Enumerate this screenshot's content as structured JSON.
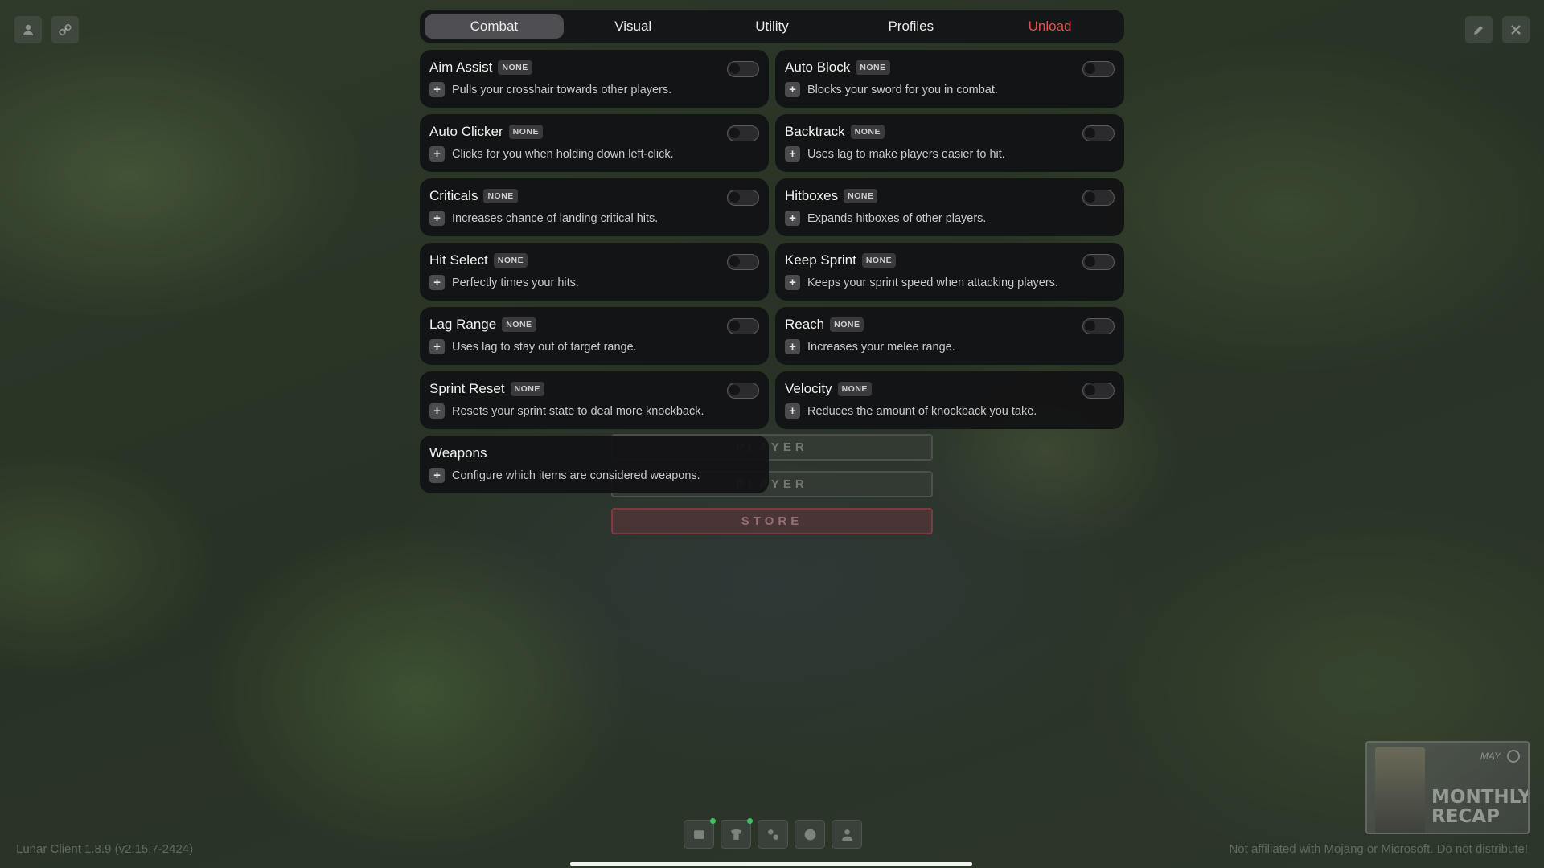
{
  "tabs": [
    {
      "label": "Combat",
      "active": true
    },
    {
      "label": "Visual",
      "active": false
    },
    {
      "label": "Utility",
      "active": false
    },
    {
      "label": "Profiles",
      "active": false
    },
    {
      "label": "Unload",
      "active": false,
      "color": "#e2504a"
    }
  ],
  "modules": [
    {
      "title": "Aim Assist",
      "bind": "NONE",
      "description": "Pulls your crosshair towards other players.",
      "enabled": false
    },
    {
      "title": "Auto Block",
      "bind": "NONE",
      "description": "Blocks your sword for you in combat.",
      "enabled": false
    },
    {
      "title": "Auto Clicker",
      "bind": "NONE",
      "description": "Clicks for you when holding down left-click.",
      "enabled": false
    },
    {
      "title": "Backtrack",
      "bind": "NONE",
      "description": "Uses lag to make players easier to hit.",
      "enabled": false
    },
    {
      "title": "Criticals",
      "bind": "NONE",
      "description": "Increases chance of landing critical hits.",
      "enabled": false
    },
    {
      "title": "Hitboxes",
      "bind": "NONE",
      "description": "Expands hitboxes of other players.",
      "enabled": false
    },
    {
      "title": "Hit Select",
      "bind": "NONE",
      "description": "Perfectly times your hits.",
      "enabled": false
    },
    {
      "title": "Keep Sprint",
      "bind": "NONE",
      "description": "Keeps your sprint speed when attacking players.",
      "enabled": false
    },
    {
      "title": "Lag Range",
      "bind": "NONE",
      "description": "Uses lag to stay out of target range.",
      "enabled": false
    },
    {
      "title": "Reach",
      "bind": "NONE",
      "description": "Increases your melee range.",
      "enabled": false
    },
    {
      "title": "Sprint Reset",
      "bind": "NONE",
      "description": "Resets your sprint state to deal more knockback.",
      "enabled": false
    },
    {
      "title": "Velocity",
      "bind": "NONE",
      "description": "Reduces the amount of knockback you take.",
      "enabled": false
    },
    {
      "title": "Weapons",
      "description": "Configure which items are considered weapons."
    }
  ],
  "background_menu": {
    "buttons": [
      "PLAYER",
      "PLAYER",
      "STORE"
    ]
  },
  "corner_icons": {
    "left": [
      "person-icon",
      "link-icon"
    ],
    "right": [
      "edit-icon",
      "close-icon"
    ]
  },
  "bottom_icons": [
    "screenshot-icon",
    "cosmetics-icon",
    "settings-icon",
    "globe-icon",
    "friends-icon"
  ],
  "footer": {
    "version": "Lunar Client 1.8.9 (v2.15.7-2424)",
    "disclaimer": "Not affiliated with Mojang or Microsoft. Do not distribute!"
  },
  "recap": {
    "month": "MAY",
    "title": "MONTHLY RECAP"
  },
  "colors": {
    "accent_danger": "#e2504a",
    "card_bg": "#141416",
    "active_tab": "#4d4d52",
    "notification_dot": "#3fbf63"
  }
}
